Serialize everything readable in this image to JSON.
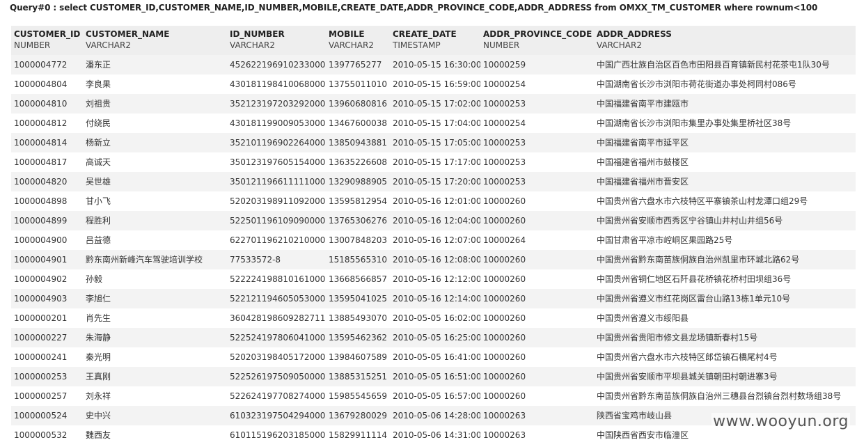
{
  "query": {
    "text": "Query#0 : select CUSTOMER_ID,CUSTOMER_NAME,ID_NUMBER,MOBILE,CREATE_DATE,ADDR_PROVINCE_CODE,ADDR_ADDRESS from OMXX_TM_CUSTOMER where rownum<100"
  },
  "columns": [
    {
      "name": "CUSTOMER_ID",
      "type": "NUMBER"
    },
    {
      "name": "CUSTOMER_NAME",
      "type": "VARCHAR2"
    },
    {
      "name": "ID_NUMBER",
      "type": "VARCHAR2"
    },
    {
      "name": "MOBILE",
      "type": "VARCHAR2"
    },
    {
      "name": "CREATE_DATE",
      "type": "TIMESTAMP"
    },
    {
      "name": "ADDR_PROVINCE_CODE",
      "type": "NUMBER"
    },
    {
      "name": "ADDR_ADDRESS",
      "type": "VARCHAR2"
    }
  ],
  "rows": [
    [
      "1000004772",
      "潘东正",
      "452622196910233000",
      "1397765277",
      "2010-05-15 16:30:00",
      "10000259",
      "中国广西壮族自治区百色市田阳县百育镇新民村花茶屯1队30号"
    ],
    [
      "1000004804",
      "李良果",
      "430181198410068000",
      "13755011010",
      "2010-05-15 16:59:00",
      "10000254",
      "中国湖南省长沙市浏阳市荷花街道办事处柯同村086号"
    ],
    [
      "1000004810",
      "刘祖贵",
      "352123197203292000",
      "13960680816",
      "2010-05-15 17:02:00",
      "10000253",
      "中国福建省南平市建瓯市"
    ],
    [
      "1000004812",
      "付绕民",
      "430181199009053000",
      "13467600038",
      "2010-05-15 17:04:00",
      "10000254",
      "中国湖南省长沙市浏阳市集里办事处集里桥社区38号"
    ],
    [
      "1000004814",
      "杨新立",
      "352101196902264000",
      "13850943881",
      "2010-05-15 17:05:00",
      "10000253",
      "中国福建省南平市延平区"
    ],
    [
      "1000004817",
      "高诚天",
      "350123197605154000",
      "13635226608",
      "2010-05-15 17:17:00",
      "10000253",
      "中国福建省福州市鼓楼区"
    ],
    [
      "1000004820",
      "吴世雄",
      "350121196611111000",
      "13290988905",
      "2010-05-15 17:20:00",
      "10000253",
      "中国福建省福州市晋安区"
    ],
    [
      "1000004898",
      "甘小飞",
      "520203198911092000",
      "13595812954",
      "2010-05-16 12:01:00",
      "10000260",
      "中国贵州省六盘水市六枝特区平寨镇茶山村龙潭口组29号"
    ],
    [
      "1000004899",
      "程胜利",
      "522501196109090000",
      "13765306276",
      "2010-05-16 12:04:00",
      "10000260",
      "中国贵州省安顺市西秀区宁谷镇山井村山井组56号"
    ],
    [
      "1000004900",
      "吕益德",
      "622701196210210000",
      "13007848203",
      "2010-05-16 12:07:00",
      "10000264",
      "中国甘肃省平凉市崆峒区果园路25号"
    ],
    [
      "1000004901",
      "黔东南州新峰汽车驾驶培训学校",
      "77533572-8",
      "15185565310",
      "2010-05-16 12:08:00",
      "10000260",
      "中国贵州省黔东南苗族侗族自治州凯里市环城北路62号"
    ],
    [
      "1000004902",
      "孙毅",
      "522224198810161000",
      "13668566857",
      "2010-05-16 12:12:00",
      "10000260",
      "中国贵州省铜仁地区石阡县花桥镇花桥村田坝组36号"
    ],
    [
      "1000004903",
      "李旭仁",
      "522121194605053000",
      "13595041025",
      "2010-05-16 12:14:00",
      "10000260",
      "中国贵州省遵义市红花岗区雷台山路13栋1单元10号"
    ],
    [
      "1000000201",
      "肖先生",
      "360428198609282711",
      "13885493070",
      "2010-05-05 16:02:00",
      "10000260",
      "中国贵州省遵义市绥阳县"
    ],
    [
      "1000000227",
      "朱海静",
      "522524197806041000",
      "13595462362",
      "2010-05-05 16:25:00",
      "10000260",
      "中国贵州省贵阳市修文县龙场镇新春村15号"
    ],
    [
      "1000000241",
      "秦光明",
      "520203198405172000",
      "13984607589",
      "2010-05-05 16:41:00",
      "10000260",
      "中国贵州省六盘水市六枝特区郎岱镇石橋尾村4号"
    ],
    [
      "1000000253",
      "王真刚",
      "522526197509050000",
      "13885315251",
      "2010-05-05 16:51:00",
      "10000260",
      "中国贵州省安顺市平坝县城关镇朝田村朝进寨3号"
    ],
    [
      "1000000257",
      "刘永祥",
      "522624197708274000",
      "15985545659",
      "2010-05-05 16:57:00",
      "10000260",
      "中国贵州省黔东南苗族侗族自治州三穗县台烈镇台烈村数场组38号"
    ],
    [
      "1000000524",
      "史中兴",
      "610323197504294000",
      "13679280029",
      "2010-05-06 14:28:00",
      "10000263",
      "陕西省宝鸡市岐山县"
    ],
    [
      "1000000532",
      "魏西友",
      "610115196203185000",
      "15829911114",
      "2010-05-06 14:31:00",
      "10000263",
      "中国陕西省西安市临潼区"
    ]
  ],
  "watermark": {
    "text": "www.wooyun.org"
  }
}
